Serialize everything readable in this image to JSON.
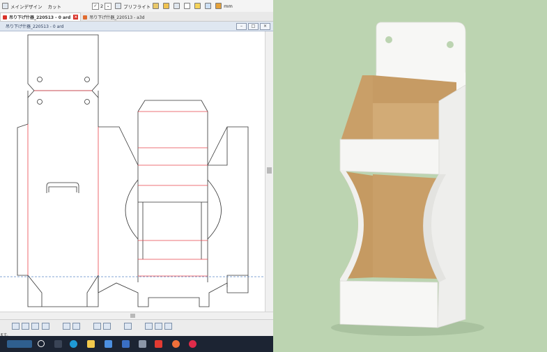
{
  "toolbar": {
    "menu_design": "メインデザイン",
    "cut": "カット",
    "count_value": "2",
    "preflight": "プリフライト",
    "unit": "mm"
  },
  "tabs": [
    {
      "label": "吊り下げ什器_220513 - 0 ard"
    },
    {
      "label": "吊り下げ什器_220513 - a3d"
    }
  ],
  "document_window": {
    "title": "吊り下げ什器_220513 - 0 ard"
  },
  "status": {
    "text": "ます。"
  },
  "colors": {
    "cut_line": "#333333",
    "crease_line": "#e8424a",
    "guide_line": "#5b88c8",
    "photo_background": "#bcd4b1",
    "board_inner": "#c99f68"
  },
  "taskbar_icons": [
    "start-icon",
    "search-icon",
    "task-view-icon",
    "edge-icon",
    "explorer-icon",
    "store-icon",
    "mail-icon",
    "app-cube-icon",
    "pdf-icon",
    "media-icon",
    "app-red-icon"
  ]
}
